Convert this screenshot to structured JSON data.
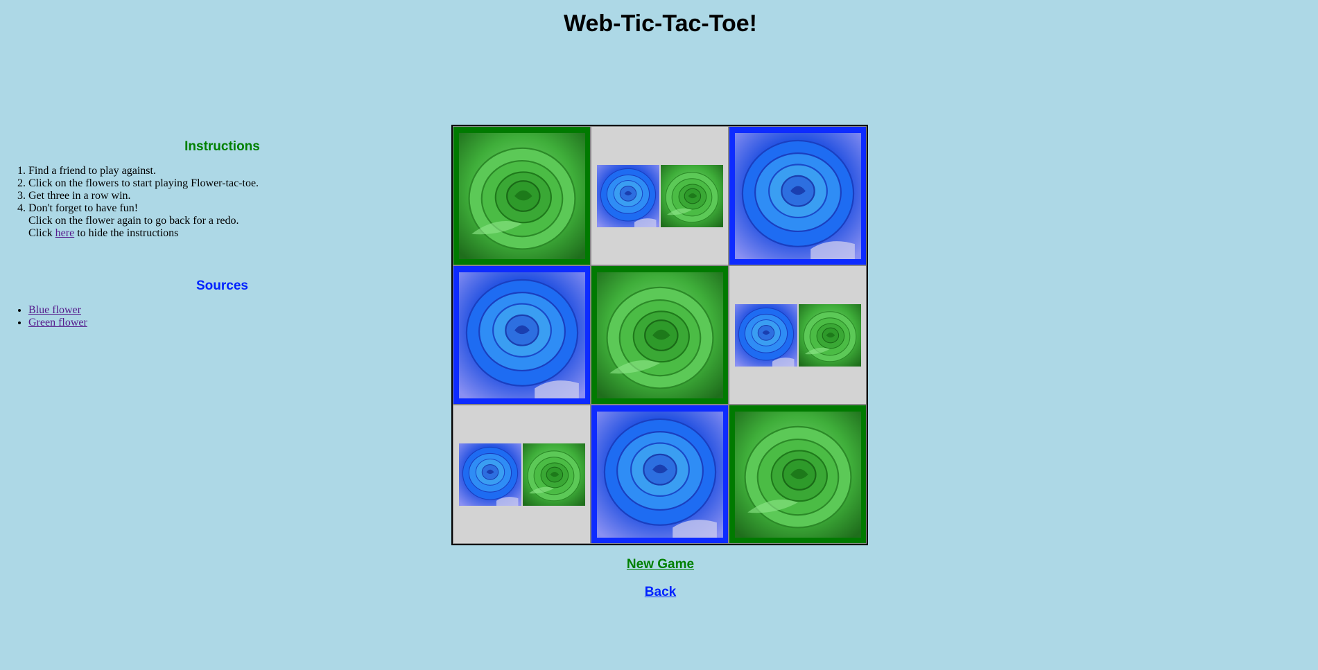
{
  "page": {
    "title": "Web-Tic-Tac-Toe!",
    "background_color": "#add8e6"
  },
  "instructions": {
    "heading": "Instructions",
    "heading_color": "#008000",
    "steps": [
      "Find a friend to play against.",
      "Click on the flowers to start playing Flower-tac-toe.",
      "Get three in a row win.",
      "Don't forget to have fun!"
    ],
    "redo_note": "Click on the flower again to go back for a redo.",
    "hide_prefix": "Click",
    "hide_link": "here",
    "hide_suffix": "to hide the instructions"
  },
  "sources": {
    "heading": "Sources",
    "heading_color": "#0022ff",
    "links": [
      "Blue flower",
      "Green flower"
    ]
  },
  "board": {
    "cells": [
      "green",
      "empty",
      "blue",
      "blue",
      "green",
      "empty",
      "empty",
      "blue",
      "green"
    ],
    "cell_colors": {
      "green": "#007a00",
      "blue": "#0d2bff",
      "empty": "#d3d3d3"
    },
    "pieces": {
      "blue": "blue-rose-icon",
      "green": "green-rose-icon"
    }
  },
  "actions": {
    "new_game": "New Game",
    "new_game_color": "#008000",
    "back": "Back",
    "back_color": "#0022ff"
  }
}
